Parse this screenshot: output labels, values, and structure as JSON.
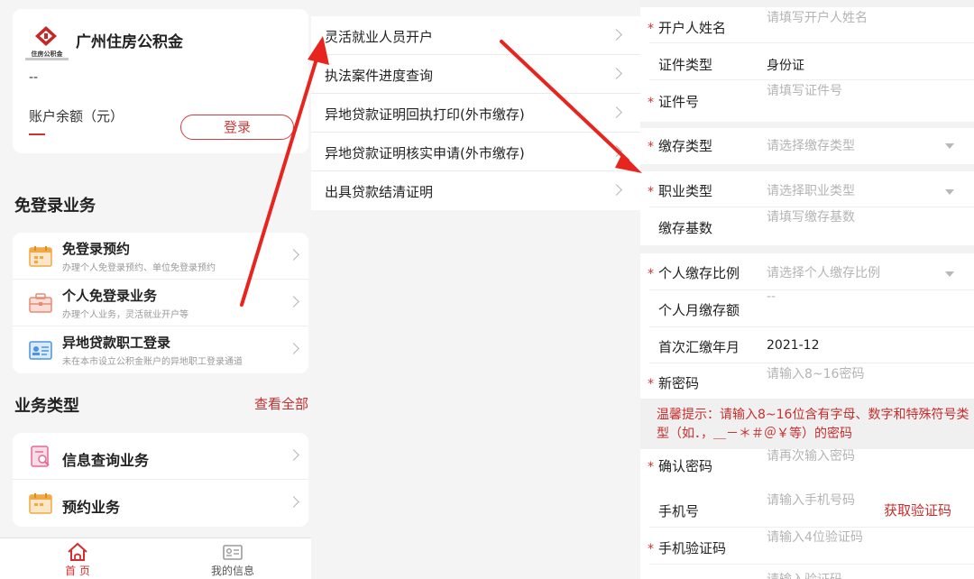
{
  "account": {
    "brand": "广州住房公积金",
    "logo_caption": "住房公积金",
    "dash": "--",
    "balance_label": "账户余额（元）",
    "login_label": "登录"
  },
  "free_login": {
    "title": "免登录业务",
    "items": [
      {
        "title": "免登录预约",
        "subtitle": "办理个人免登录预约、单位免登录预约",
        "icon": "calendar-icon"
      },
      {
        "title": "个人免登录业务",
        "subtitle": "办理个人业务，灵活就业开户等",
        "icon": "briefcase-icon"
      },
      {
        "title": "异地贷款职工登录",
        "subtitle": "未在本市设立公积金账户的异地职工登录通道",
        "icon": "id-card-icon"
      }
    ]
  },
  "business_types": {
    "title": "业务类型",
    "view_all": "查看全部",
    "items": [
      {
        "title": "信息查询业务",
        "icon": "document-search-icon"
      },
      {
        "title": "预约业务",
        "icon": "calendar-icon"
      }
    ]
  },
  "tabbar": {
    "items": [
      {
        "label": "首 页",
        "icon": "home-icon",
        "active": true
      },
      {
        "label": "我的信息",
        "icon": "profile-card-icon",
        "active": false
      }
    ]
  },
  "service_menu": {
    "items": [
      "灵活就业人员开户",
      "执法案件进度查询",
      "异地贷款证明回执打印(外市缴存)",
      "异地贷款证明核实申请(外市缴存)",
      "出具贷款结清证明"
    ]
  },
  "form": {
    "name_label": "开户人姓名",
    "name_placeholder": "请填写开户人姓名",
    "id_type_label": "证件类型",
    "id_type_value": "身份证",
    "id_no_label": "证件号",
    "id_no_placeholder": "请填写证件号",
    "deposit_type_label": "缴存类型",
    "deposit_type_placeholder": "请选择缴存类型",
    "job_type_label": "职业类型",
    "job_type_placeholder": "请选择职业类型",
    "base_label": "缴存基数",
    "base_placeholder": "请填写缴存基数",
    "ratio_label": "个人缴存比例",
    "ratio_placeholder": "请选择个人缴存比例",
    "monthly_label": "个人月缴存额",
    "monthly_value": "--",
    "first_month_label": "首次汇缴年月",
    "first_month_value": "2021-12",
    "password_label": "新密码",
    "password_placeholder": "请输入8~16密码",
    "tip": "温馨提示：请输入8~16位含有字母、数字和特殊符号类型（如．，＿－＊＃＠￥等）的密码",
    "confirm_label": "确认密码",
    "confirm_placeholder": "请再次输入密码",
    "phone_label": "手机号",
    "phone_placeholder": "请输入手机号码",
    "get_code_label": "获取验证码",
    "sms_label": "手机验证码",
    "sms_placeholder": "请输入4位验证码",
    "captcha_placeholder": "请输入验证码",
    "required_mark": "*"
  },
  "colors": {
    "brand_red": "#c92d2d",
    "annotation_red": "#e8241e",
    "placeholder": "#b4b4b4"
  }
}
